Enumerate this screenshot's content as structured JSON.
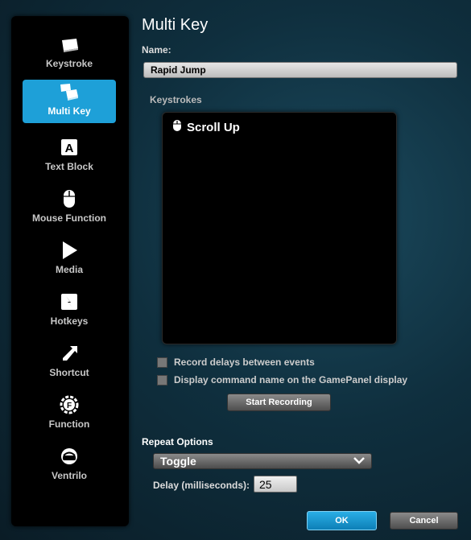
{
  "sidebar": {
    "items": [
      {
        "label": "Keystroke",
        "icon": "keystroke-icon"
      },
      {
        "label": "Multi Key",
        "icon": "multi-key-icon",
        "active": true
      },
      {
        "label": "Text Block",
        "icon": "text-block-icon"
      },
      {
        "label": "Mouse Function",
        "icon": "mouse-icon"
      },
      {
        "label": "Media",
        "icon": "play-icon"
      },
      {
        "label": "Hotkeys",
        "icon": "hotkeys-icon"
      },
      {
        "label": "Shortcut",
        "icon": "shortcut-arrow-icon"
      },
      {
        "label": "Function",
        "icon": "function-gear-icon"
      },
      {
        "label": "Ventrilo",
        "icon": "headset-icon"
      }
    ]
  },
  "main": {
    "title": "Multi Key",
    "name_label": "Name:",
    "name_value": "Rapid Jump",
    "keystrokes_label": "Keystrokes",
    "keystrokes": [
      {
        "text": "Scroll Up",
        "icon": "mouse-icon"
      }
    ],
    "record_delays_label": "Record delays between events",
    "record_delays_checked": false,
    "display_name_label": "Display command name on the GamePanel display",
    "display_name_checked": false,
    "start_recording_label": "Start Recording",
    "repeat_options_label": "Repeat Options",
    "repeat_value": "Toggle",
    "delay_label": "Delay (milliseconds):",
    "delay_value": "25"
  },
  "footer": {
    "ok_label": "OK",
    "cancel_label": "Cancel"
  },
  "colors": {
    "accent": "#1ea0d8",
    "background": "#0f2f3e"
  }
}
